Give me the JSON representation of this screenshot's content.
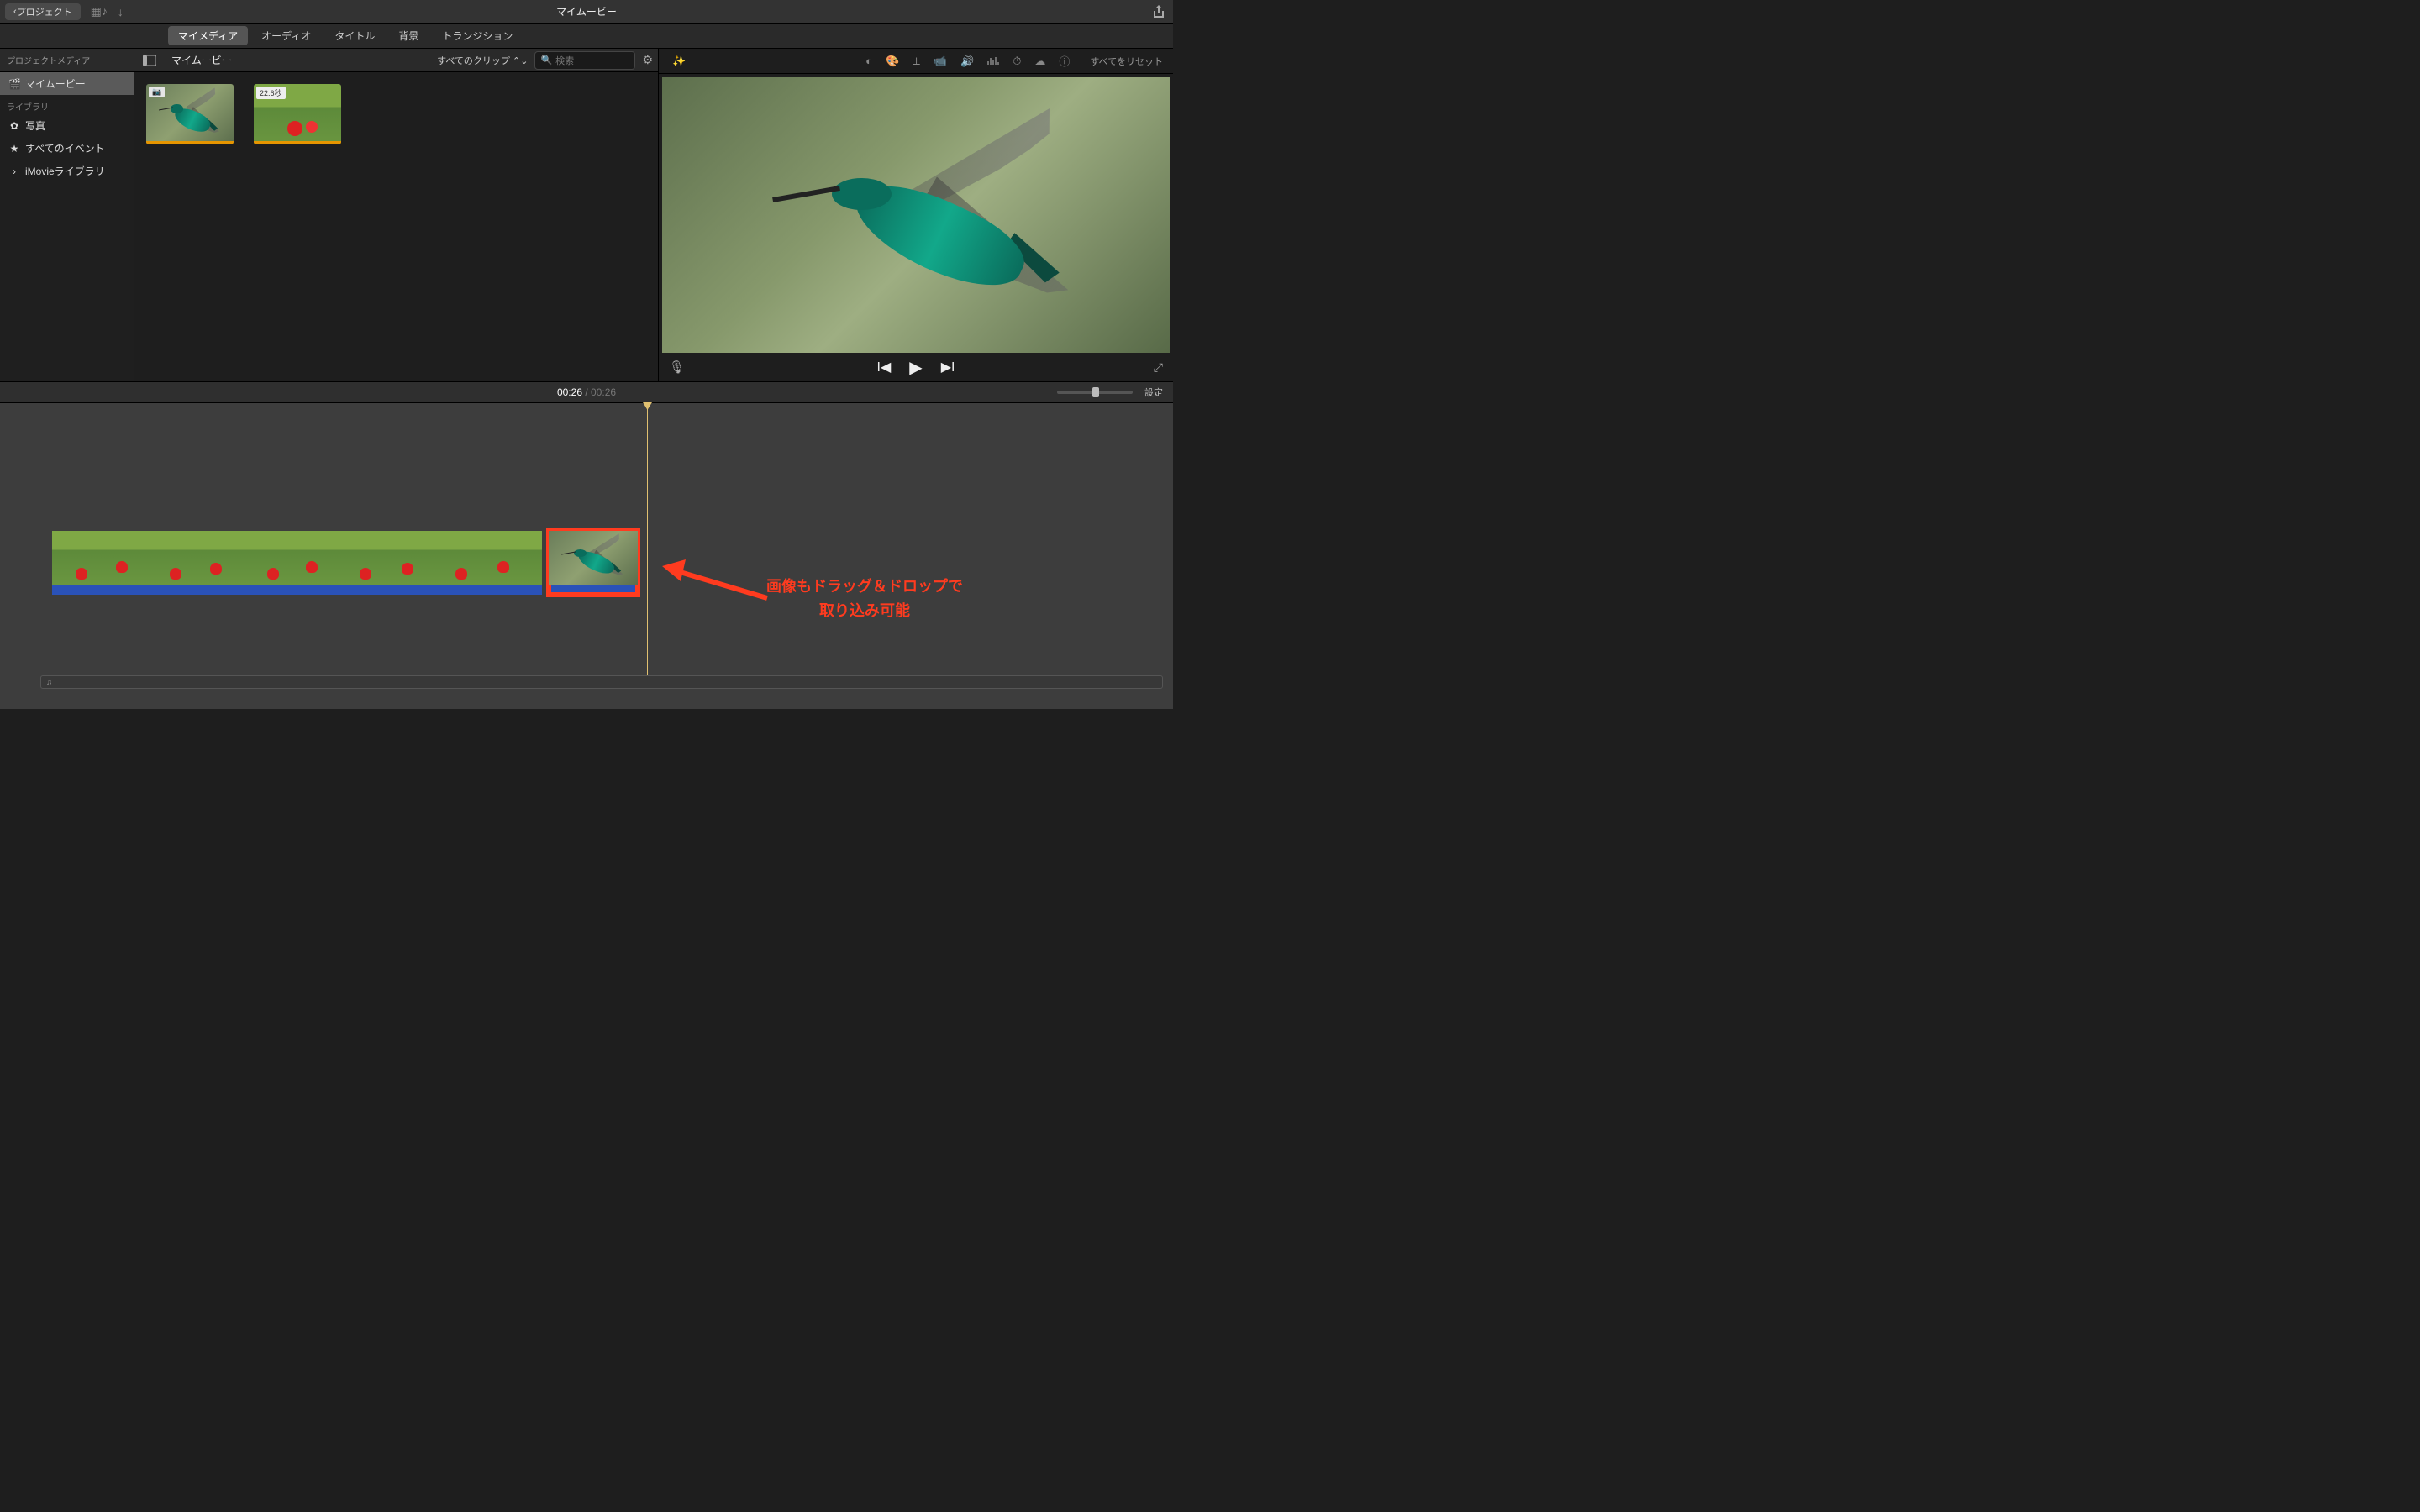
{
  "titlebar": {
    "back": "プロジェクト",
    "title": "マイムービー"
  },
  "tabs": {
    "my_media": "マイメディア",
    "audio": "オーディオ",
    "titles": "タイトル",
    "backgrounds": "背景",
    "transitions": "トランジション"
  },
  "sidebar": {
    "project_media": "プロジェクトメディア",
    "my_movie": "マイムービー",
    "library": "ライブラリ",
    "photos": "写真",
    "all_events": "すべてのイベント",
    "imovie_library": "iMovieライブラリ"
  },
  "browser": {
    "title": "マイムービー",
    "filter": "すべてのクリップ",
    "search_placeholder": "検索",
    "clip2_duration": "22.6秒"
  },
  "adjust": {
    "reset": "すべてをリセット"
  },
  "timeline": {
    "current": "00:26",
    "total": "00:26",
    "settings": "設定"
  },
  "annotation": {
    "line1": "画像もドラッグ＆ドロップで",
    "line2": "取り込み可能"
  }
}
